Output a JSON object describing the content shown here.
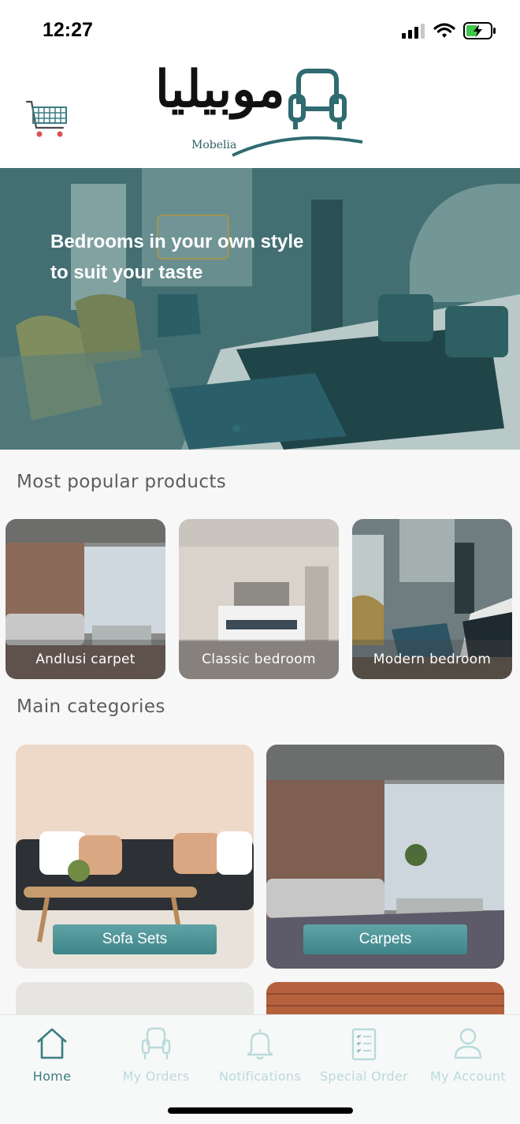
{
  "status_bar": {
    "time": "12:27"
  },
  "header": {
    "logo_arabic": "موبيليا",
    "logo_english": "Mobelia"
  },
  "hero": {
    "headline_line1": "Bedrooms in your own style",
    "headline_line2": "to suit your taste"
  },
  "popular": {
    "title": "Most popular products",
    "items": [
      {
        "label": "Andlusi carpet"
      },
      {
        "label": "Classic bedroom"
      },
      {
        "label": "Modern bedroom"
      }
    ]
  },
  "categories": {
    "title": "Main categories",
    "items": [
      {
        "label": "Sofa Sets"
      },
      {
        "label": "Carpets"
      }
    ]
  },
  "tabbar": {
    "items": [
      {
        "label": "Home",
        "icon": "home-icon",
        "active": true
      },
      {
        "label": "My Orders",
        "icon": "armchair-icon",
        "active": false
      },
      {
        "label": "Notifications",
        "icon": "bell-icon",
        "active": false
      },
      {
        "label": "Special Order",
        "icon": "clipboard-icon",
        "active": false
      },
      {
        "label": "My Account",
        "icon": "user-icon",
        "active": false
      }
    ]
  },
  "colors": {
    "brand": "#3d7d82",
    "tab_active": "#3d7d82",
    "tab_inactive": "#b9dadb"
  }
}
